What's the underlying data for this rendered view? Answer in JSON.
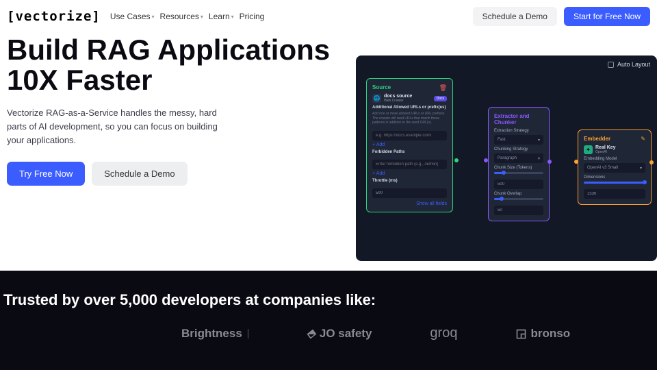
{
  "header": {
    "logo": "[vectorize]",
    "nav": [
      {
        "label": "Use Cases",
        "dropdown": true
      },
      {
        "label": "Resources",
        "dropdown": true
      },
      {
        "label": "Learn",
        "dropdown": true
      },
      {
        "label": "Pricing",
        "dropdown": false
      }
    ],
    "schedule": "Schedule a Demo",
    "start": "Start for Free Now"
  },
  "hero": {
    "title_l1": "Build RAG Applications",
    "title_l2": "10X Faster",
    "subtitle": "Vectorize RAG-as-a-Service handles the messy, hard parts of AI development, so you can focus on building your applications.",
    "try": "Try Free Now",
    "demo": "Schedule a Demo"
  },
  "diagram": {
    "auto_layout": "Auto Layout",
    "source": {
      "title": "Source",
      "name": "docs source",
      "type": "Web Crawler",
      "badge": "Docs",
      "urls_label": "Additional Allowed URLs or prefix(es)",
      "urls_help": "Add one or more allowed URLs or URL prefixes. The crawler will read URLs that match these patterns in addition to the seed URL(s).",
      "urls_placeholder": "e.g. https://docs.example.com/",
      "add": "+ Add",
      "forbidden_label": "Forbidden Paths",
      "forbidden_placeholder": "Enter forbidden path (e.g., /admin)",
      "throttle_label": "Throttle (ms)",
      "throttle_value": "500",
      "show_all": "Show all fields"
    },
    "extractor": {
      "title": "Extractor and Chunker",
      "strat_label": "Extraction Strategy",
      "strat_value": "Fast",
      "chunk_strat_label": "Chunking Strategy",
      "chunk_strat_value": "Paragraph",
      "chunk_size_label": "Chunk Size (Tokens)",
      "chunk_size_value": "500",
      "overlap_label": "Chunk Overlap",
      "overlap_value": "50"
    },
    "embedder": {
      "title": "Embedder",
      "key_name": "Real Key",
      "key_provider": "OpenAI",
      "model_label": "Embedding Model",
      "model_value": "OpenAI v3 Small",
      "dim_label": "Dimensions",
      "dim_value": "1536"
    }
  },
  "trusted": {
    "heading": "Trusted by over 5,000 developers at companies like:",
    "logos": [
      "Brightness",
      "JO safety",
      "groq",
      "bronso"
    ]
  }
}
